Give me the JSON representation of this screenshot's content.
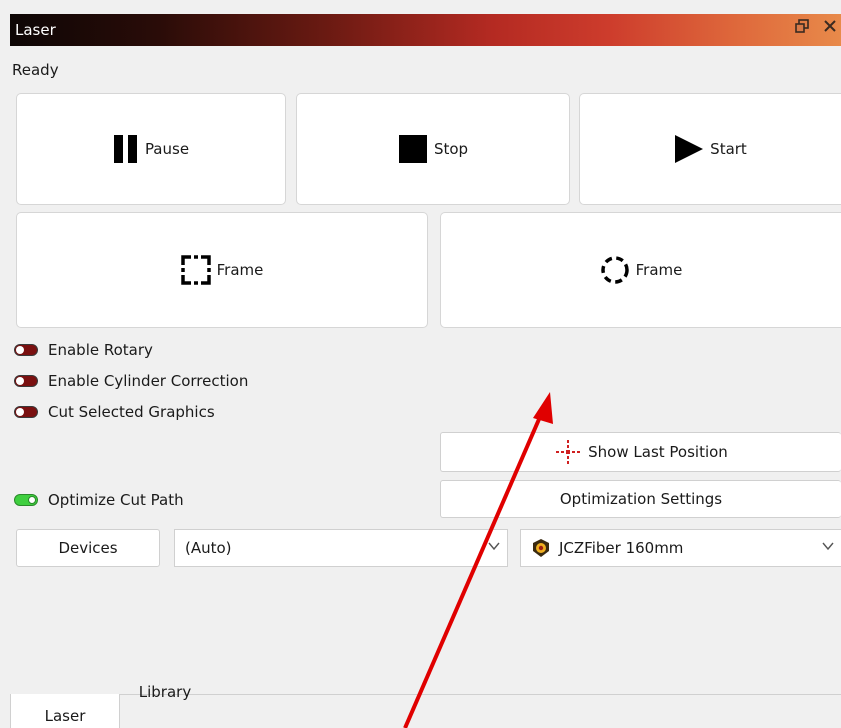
{
  "window": {
    "title": "Laser",
    "float_icon": "float-window-icon",
    "close_icon": "close-icon"
  },
  "status": "Ready",
  "controls": {
    "pause_label": "Pause",
    "stop_label": "Stop",
    "start_label": "Start",
    "frame_rect_label": "Frame",
    "frame_circle_label": "Frame"
  },
  "toggles": [
    {
      "label": "Enable Rotary",
      "state": "off"
    },
    {
      "label": "Enable Cylinder Correction",
      "state": "off"
    },
    {
      "label": "Cut Selected Graphics",
      "state": "off"
    },
    {
      "label": "Optimize Cut Path",
      "state": "on"
    }
  ],
  "buttons": {
    "show_last_position": "Show Last Position",
    "optimization_settings": "Optimization Settings",
    "devices": "Devices"
  },
  "selects": {
    "port": "(Auto)",
    "device": "JCZFiber 160mm"
  },
  "tabs": [
    {
      "label": "Laser",
      "active": true
    },
    {
      "label": "Library",
      "active": false
    }
  ],
  "colors": {
    "toggle_off": "#7a1010",
    "toggle_on": "#3fcf3f",
    "annotation_arrow": "#e00000",
    "crosshair": "#d02020"
  }
}
